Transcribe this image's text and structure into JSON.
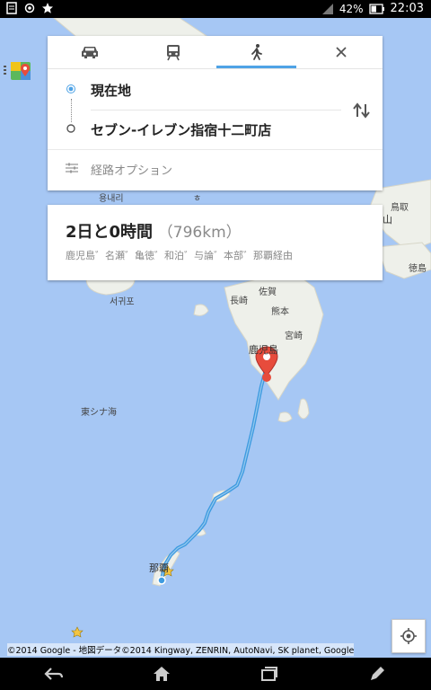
{
  "status": {
    "battery": "42%",
    "time": "22:03"
  },
  "modes": [
    {
      "name": "car",
      "active": false
    },
    {
      "name": "transit",
      "active": false
    },
    {
      "name": "walk",
      "active": true
    }
  ],
  "route": {
    "origin": "現在地",
    "destination": "セブン-イレブン指宿十二町店",
    "options": "経路オプション"
  },
  "summary": {
    "duration": "2日と0時間",
    "distance": "（796km）",
    "via": "鹿児島゛名瀬゛亀徳゛和泊゛与論゛本部゛那覇経由"
  },
  "map": {
    "labels": {
      "tottori": "鳥取",
      "okayama": "山",
      "tokushima": "徳島",
      "nagasaki": "長崎",
      "saga": "佐賀",
      "kumamoto": "熊本",
      "miyazaki": "宮崎",
      "kagoshima": "鹿児島",
      "seogwipo": "서귀포",
      "east_china_sea": "東シナ海",
      "naha": "那覇",
      "onaeri": "용내리",
      "top_partial": "ㅎ"
    },
    "colors": {
      "water": "#a6c7f4",
      "route": "#3e9be0",
      "marker": "#e74c3c"
    },
    "copyright": "©2014 Google - 地図データ©2014 Kingway, ZENRIN, AutoNavi, SK planet, Google"
  }
}
